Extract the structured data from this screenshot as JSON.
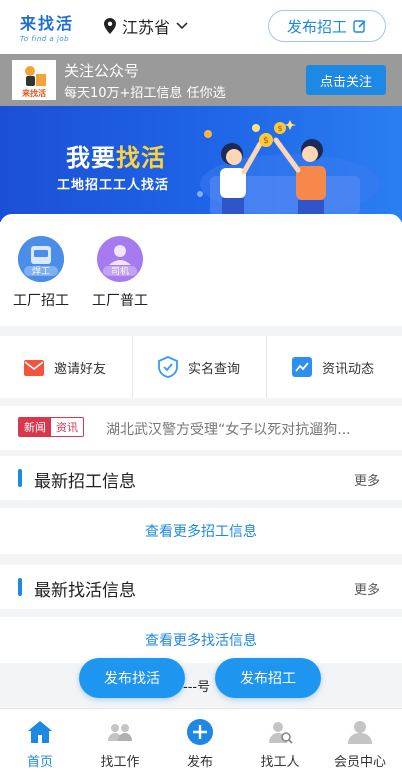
{
  "header": {
    "logo_cn": "来找活",
    "logo_en": "To find a job",
    "location": "江苏省",
    "post_job_button": "发布招工"
  },
  "follow_bar": {
    "title": "关注公众号",
    "subtitle": "每天10万+招工信息 任你选",
    "button": "点击关注",
    "badge_text": "来找活"
  },
  "banner": {
    "headline_part1": "我要",
    "headline_part2": "找活",
    "subline": "工地招工工人找活"
  },
  "categories": [
    {
      "label": "工厂招工",
      "badge": "焊工",
      "color": "#4a90e8"
    },
    {
      "label": "工厂普工",
      "badge": "司机",
      "color": "#a77bf0"
    }
  ],
  "quick_links": [
    {
      "label": "邀请好友",
      "icon": "envelope-icon",
      "color": "#f2543d"
    },
    {
      "label": "实名查询",
      "icon": "shield-check-icon",
      "color": "#3a9bf0"
    },
    {
      "label": "资讯动态",
      "icon": "trend-chart-icon",
      "color": "#2f8ff0"
    }
  ],
  "news": {
    "tag_a": "新闻",
    "tag_b": "资讯",
    "headline": "湖北武汉警方受理“女子以死对抗遛狗..."
  },
  "sections": {
    "jobs_title": "最新招工信息",
    "jobs_more": "更多",
    "jobs_link": "查看更多招工信息",
    "work_title": "最新找活信息",
    "work_more": "更多",
    "work_link": "查看更多找活信息"
  },
  "floating": {
    "left": "发布找活",
    "middle": "---号",
    "right": "发布招工"
  },
  "tabbar": [
    {
      "label": "首页",
      "active": true
    },
    {
      "label": "找工作",
      "active": false
    },
    {
      "label": "发布",
      "active": false
    },
    {
      "label": "找工人",
      "active": false
    },
    {
      "label": "会员中心",
      "active": false
    }
  ],
  "colors": {
    "primary": "#1e88e5",
    "banner": "#1f5fe0",
    "news_red": "#d9374b"
  }
}
